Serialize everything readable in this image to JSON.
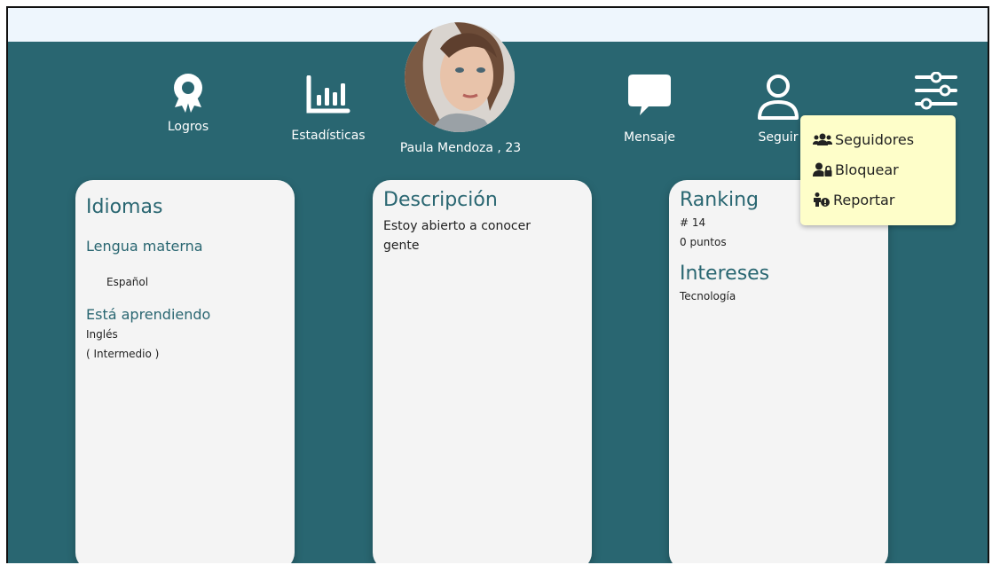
{
  "nav": {
    "logros": "Logros",
    "estadisticas": "Estadísticas",
    "mensaje": "Mensaje",
    "seguir": "Seguir"
  },
  "profile": {
    "name_age": "Paula Mendoza , 23"
  },
  "dropdown": {
    "items": [
      {
        "label": "Seguidores",
        "icon": "users-icon"
      },
      {
        "label": "Bloquear",
        "icon": "user-lock-icon"
      },
      {
        "label": "Reportar",
        "icon": "user-report-icon"
      }
    ]
  },
  "idiomas": {
    "title": "Idiomas",
    "native_heading": "Lengua materna",
    "native_value": "Español",
    "learning_heading": "Está aprendiendo",
    "learning_language": "Inglés",
    "learning_level": "( Intermedio )"
  },
  "descripcion": {
    "title": "Descripción",
    "text": "Estoy abierto a conocer gente"
  },
  "ranking": {
    "title": "Ranking",
    "position": "# 14",
    "points": "0 puntos"
  },
  "intereses": {
    "title": "Intereses",
    "value": "Tecnología"
  },
  "colors": {
    "background": "#296671",
    "topbar": "#eef6fd",
    "card": "#f4f4f4",
    "dropdown": "#fefec9",
    "accent_text": "#296671"
  }
}
